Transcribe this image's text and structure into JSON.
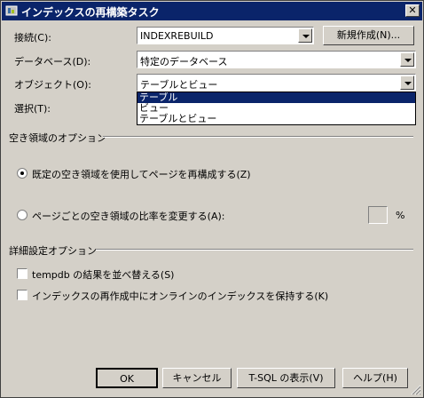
{
  "window": {
    "title": "インデックスの再構築タスク",
    "close_label": "✕"
  },
  "connection": {
    "label": "接続(C):",
    "value": "INDEXREBUILD",
    "new_button": "新規作成(N)..."
  },
  "database": {
    "label": "データベース(D):",
    "value": "特定のデータベース"
  },
  "object": {
    "label": "オブジェクト(O):",
    "value": "テーブルとビュー",
    "options": [
      "テーブル",
      "ビュー",
      "テーブルとビュー"
    ],
    "highlighted_index": 0
  },
  "selection": {
    "label": "選択(T):"
  },
  "free_space": {
    "heading": "空き領域のオプション",
    "option_default": "既定の空き領域を使用してページを再構成する(Z)",
    "option_percent": "ページごとの空き領域の比率を変更する(A):",
    "percent_value": "",
    "percent_unit": "%",
    "selected": "default"
  },
  "advanced": {
    "heading": "詳細設定オプション",
    "sort_tempdb": "tempdb の結果を並べ替える(S)",
    "keep_online": "インデックスの再作成中にオンラインのインデックスを保持する(K)"
  },
  "footer": {
    "ok": "OK",
    "cancel": "キャンセル",
    "tsql": "T-SQL の表示(V)",
    "help": "ヘルプ(H)"
  },
  "colors": {
    "titlebar": "#0a246a",
    "dialog_bg": "#d4d0c8",
    "selection": "#0a246a"
  }
}
